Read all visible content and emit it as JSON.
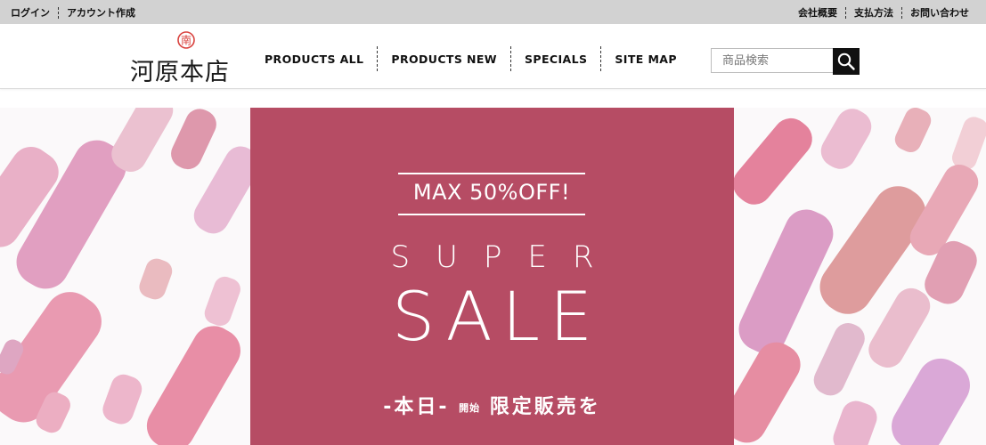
{
  "topbar": {
    "left_links": [
      "ログイン",
      "アカウント作成"
    ],
    "right_links": [
      "会社概要",
      "支払方法",
      "お問い合わせ"
    ]
  },
  "header": {
    "brand_name": "河原本店",
    "seal_char": "南",
    "nav": [
      "PRODUCTS ALL",
      "PRODUCTS NEW",
      "SPECIALS",
      "SITE MAP"
    ],
    "search": {
      "placeholder": "商品検索",
      "value": ""
    }
  },
  "hero": {
    "badge": "MAX 50%OFF!",
    "super": "SUPER",
    "sale": "SALE",
    "foot_a": "-本日-",
    "foot_small": "開始",
    "foot_b": "限定販売を"
  },
  "colors": {
    "panel": "#b64c64",
    "topbar": "#d2d2d2",
    "seal": "#d9433f"
  }
}
